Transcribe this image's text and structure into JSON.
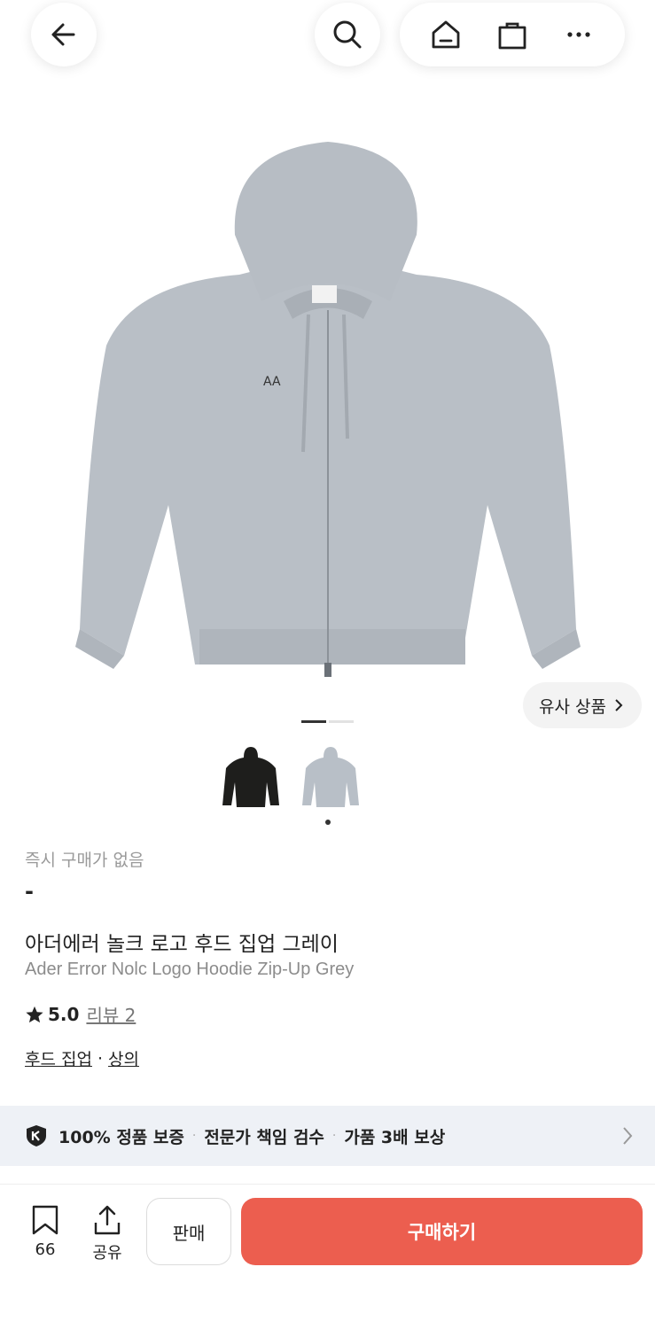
{
  "nav": {
    "back_icon": "arrow-left-icon",
    "search_icon": "search-icon",
    "home_icon": "home-icon",
    "bag_icon": "shopping-bag-icon",
    "more_icon": "more-horizontal-icon"
  },
  "gallery": {
    "similar_label": "유사 상품",
    "active_index": 1,
    "total": 2,
    "thumbnails": [
      {
        "name": "black-hoodie-thumbnail",
        "color": "#1e1e1c"
      },
      {
        "name": "grey-hoodie-thumbnail",
        "color": "#b8bfc7"
      }
    ],
    "hero_color": "#b9bfc6"
  },
  "product": {
    "price_label": "즉시 구매가 없음",
    "price_value": "-",
    "title_ko": "아더에러 놀크 로고 후드 집업 그레이",
    "title_en": "Ader Error Nolc Logo Hoodie Zip-Up Grey",
    "rating": "5.0",
    "reviews": "리뷰 2",
    "categories": [
      "후드 집업",
      "상의"
    ],
    "category_separator": "·"
  },
  "banner": {
    "items": [
      "100% 정품 보증",
      "전문가 책임 검수",
      "가품 3배 보상"
    ],
    "separator": "·"
  },
  "bottom_bar": {
    "save_count": "66",
    "share_label": "공유",
    "sell_label": "판매",
    "buy_label": "구매하기",
    "buy_color": "#ec5e4f"
  }
}
